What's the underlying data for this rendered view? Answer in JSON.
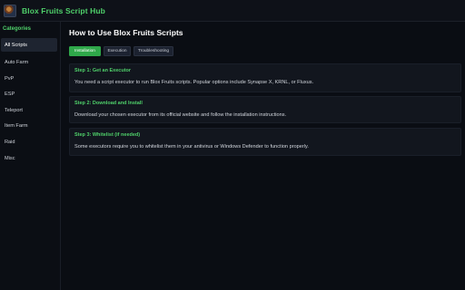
{
  "header": {
    "logo_icon": "game-avatar-icon",
    "title": "Blox Fruits Script Hub"
  },
  "sidebar": {
    "heading": "Categories",
    "items": [
      {
        "label": "All Scripts",
        "active": true
      },
      {
        "label": "Auto Farm",
        "active": false
      },
      {
        "label": "PvP",
        "active": false
      },
      {
        "label": "ESP",
        "active": false
      },
      {
        "label": "Teleport",
        "active": false
      },
      {
        "label": "Item Farm",
        "active": false
      },
      {
        "label": "Raid",
        "active": false
      },
      {
        "label": "Misc",
        "active": false
      }
    ]
  },
  "main": {
    "title": "How to Use Blox Fruits Scripts",
    "tabs": [
      {
        "label": "Installation",
        "active": true
      },
      {
        "label": "Execution",
        "active": false
      },
      {
        "label": "Troubleshooting",
        "active": false
      }
    ],
    "steps": [
      {
        "title": "Step 1: Get an Executor",
        "body": "You need a script executor to run Blox Fruits scripts. Popular options include Synapse X, KRNL, or Fluxus."
      },
      {
        "title": "Step 2: Download and Install",
        "body": "Download your chosen executor from its official website and follow the installation instructions."
      },
      {
        "title": "Step 3: Whitelist (if needed)",
        "body": "Some executors require you to whitelist them in your antivirus or Windows Defender to function properly."
      }
    ]
  },
  "colors": {
    "accent": "#4fd06a",
    "active_tab": "#2fa84a",
    "background": "#0a0d13",
    "card": "#12161e"
  }
}
